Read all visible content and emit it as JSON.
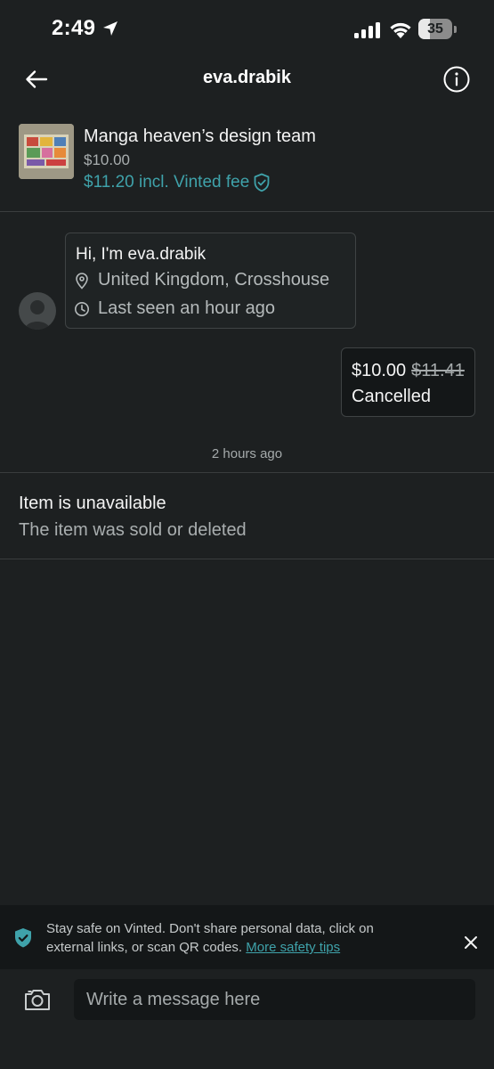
{
  "status_bar": {
    "time": "2:49",
    "battery_level": 35,
    "battery_label": "35",
    "icons": [
      "location-arrow-icon",
      "signal-icon",
      "wifi-icon",
      "battery-icon"
    ]
  },
  "header": {
    "title": "eva.drabik",
    "back_icon": "arrow-left-icon",
    "info_icon": "info-icon"
  },
  "item": {
    "title": "Manga heaven’s design team",
    "price": "$10.00",
    "price_with_fee": "$11.20",
    "fee_label": "incl. Vinted fee",
    "fee_icon": "shield-check-icon"
  },
  "intro": {
    "greeting": "Hi, I'm eva.drabik",
    "location": "United Kingdom, Crosshouse",
    "last_seen": "Last seen an hour ago"
  },
  "offer": {
    "price": "$10.00",
    "original_price": "$11.41",
    "status": "Cancelled"
  },
  "timestamp": "2 hours ago",
  "unavailable": {
    "title": "Item is unavailable",
    "subtitle": "The item was sold or deleted"
  },
  "safety": {
    "text": "Stay safe on Vinted. Don't share personal data, click on external links, or scan QR codes.",
    "link": "More safety tips"
  },
  "composer": {
    "placeholder": "Write a message here",
    "value": ""
  },
  "colors": {
    "background": "#1d2021",
    "accent": "#3fa2aa",
    "panel": "#141718",
    "divider": "#3a3d3e"
  }
}
